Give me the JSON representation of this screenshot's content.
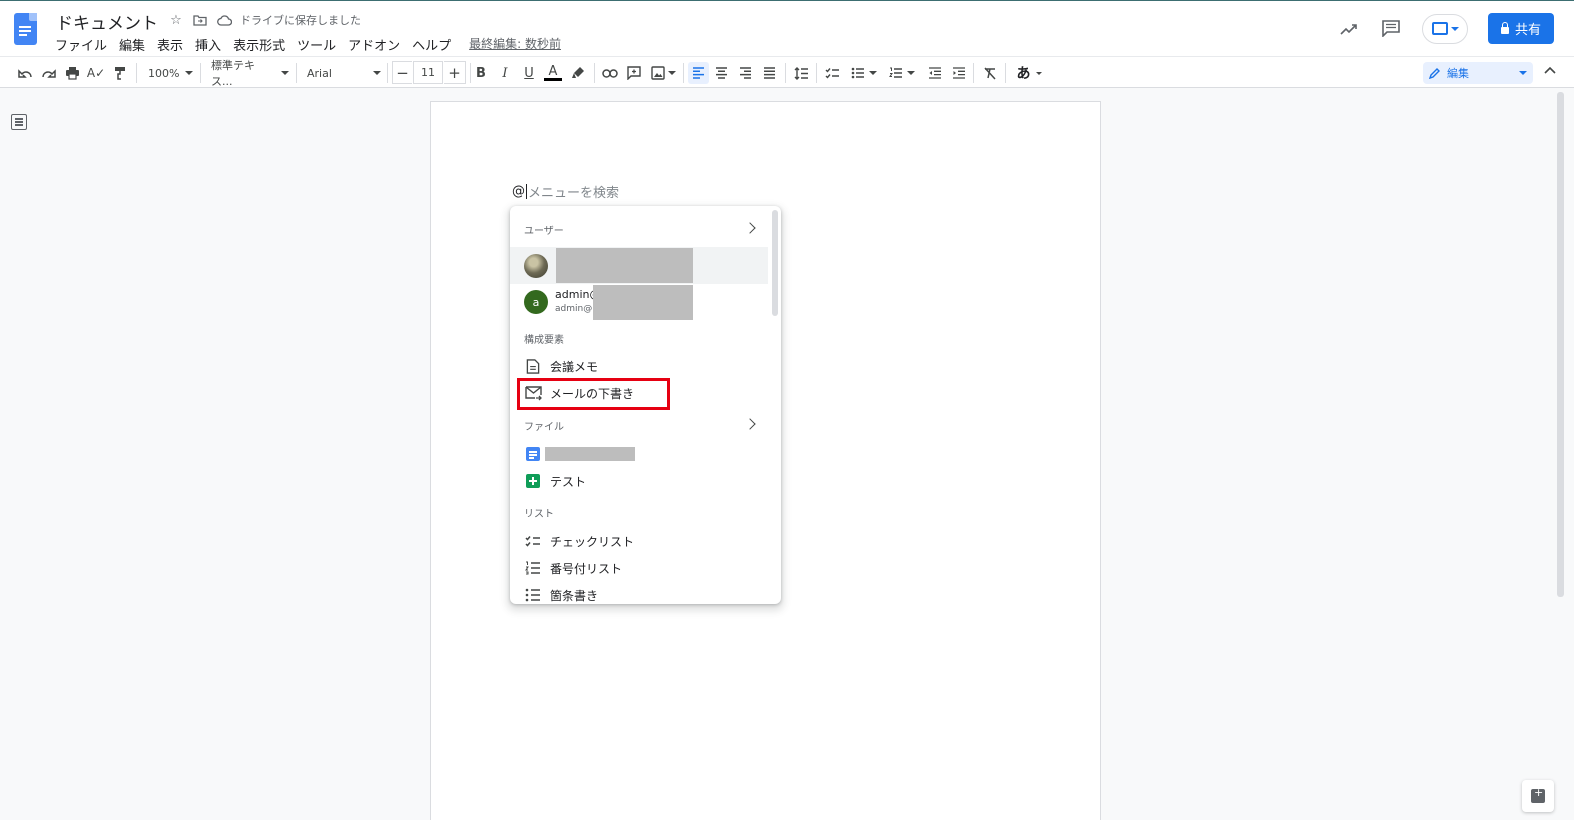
{
  "header": {
    "title": "ドキュメント",
    "saved_status": "ドライブに保存しました",
    "menus": [
      "ファイル",
      "編集",
      "表示",
      "挿入",
      "表示形式",
      "ツール",
      "アドオン",
      "ヘルプ"
    ],
    "last_edit": "最終編集: 数秒前",
    "share_label": "共有"
  },
  "toolbar": {
    "zoom": "100%",
    "style": "標準テキス...",
    "font": "Arial",
    "font_size": "11",
    "bold": "B",
    "italic": "I",
    "underline": "U",
    "text_color": "A",
    "input_tool": "あ",
    "mode": "編集"
  },
  "search": {
    "at": "@",
    "placeholder": "メニューを検索"
  },
  "menu": {
    "users_label": "ユーザー",
    "user2_main": "admin@",
    "user2_sub": "admin@",
    "user2_letter": "a",
    "components_label": "構成要素",
    "meeting_notes": "会議メモ",
    "email_draft": "メールの下書き",
    "files_label": "ファイル",
    "file_test": "テスト",
    "list_label": "リスト",
    "checklist": "チェックリスト",
    "numbered_list": "番号付リスト",
    "bulleted_list": "箇条書き"
  },
  "colors": {
    "accent": "#1a73e8",
    "highlight_box": "#e60012"
  }
}
